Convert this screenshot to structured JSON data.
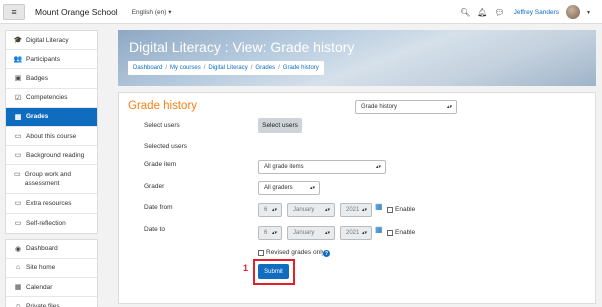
{
  "navbar": {
    "site_name": "Mount Orange School",
    "language": "English (en)",
    "user_name": "Jeffrey Sanders",
    "icons": [
      "search-icon",
      "bell-icon",
      "chat-icon"
    ]
  },
  "sidebar": {
    "course_items": [
      {
        "label": "Digital Literacy",
        "icon": "graduation-cap-icon",
        "glyph": "🎓"
      },
      {
        "label": "Participants",
        "icon": "users-icon",
        "glyph": "👥"
      },
      {
        "label": "Badges",
        "icon": "badge-icon",
        "glyph": "▣"
      },
      {
        "label": "Competencies",
        "icon": "checkbox-icon",
        "glyph": "☑"
      },
      {
        "label": "Grades",
        "icon": "table-icon",
        "glyph": "▦",
        "active": true
      },
      {
        "label": "About this course",
        "icon": "folder-icon",
        "glyph": "▭"
      },
      {
        "label": "Background reading",
        "icon": "folder-icon",
        "glyph": "▭"
      },
      {
        "label": "Group work and assessment",
        "icon": "folder-icon",
        "glyph": "▭"
      },
      {
        "label": "Extra resources",
        "icon": "folder-icon",
        "glyph": "▭"
      },
      {
        "label": "Self-reflection",
        "icon": "folder-icon",
        "glyph": "▭"
      }
    ],
    "site_items": [
      {
        "label": "Dashboard",
        "icon": "dashboard-icon",
        "glyph": "◉"
      },
      {
        "label": "Site home",
        "icon": "home-icon",
        "glyph": "⌂"
      },
      {
        "label": "Calendar",
        "icon": "calendar-icon",
        "glyph": "▦"
      },
      {
        "label": "Private files",
        "icon": "file-icon",
        "glyph": "▯"
      }
    ]
  },
  "header": {
    "title": "Digital Literacy : View: Grade history",
    "breadcrumb": [
      "Dashboard",
      "My courses",
      "Digital Literacy",
      "Grades",
      "Grade history"
    ]
  },
  "form": {
    "page_title": "Grade history",
    "report_select": "Grade history",
    "select_users_label": "Select users",
    "select_users_button": "Select users",
    "selected_users_label": "Selected users",
    "grade_item_label": "Grade item",
    "grade_item_value": "All grade items",
    "grader_label": "Grader",
    "grader_value": "All graders",
    "date_from_label": "Date from",
    "date_from": {
      "day": "6",
      "month": "January",
      "year": "2021"
    },
    "date_to_label": "Date to",
    "date_to": {
      "day": "6",
      "month": "January",
      "year": "2021"
    },
    "enable_label": "Enable",
    "revised_label": "Revised grades only",
    "submit_label": "Submit",
    "step_number": "1"
  }
}
